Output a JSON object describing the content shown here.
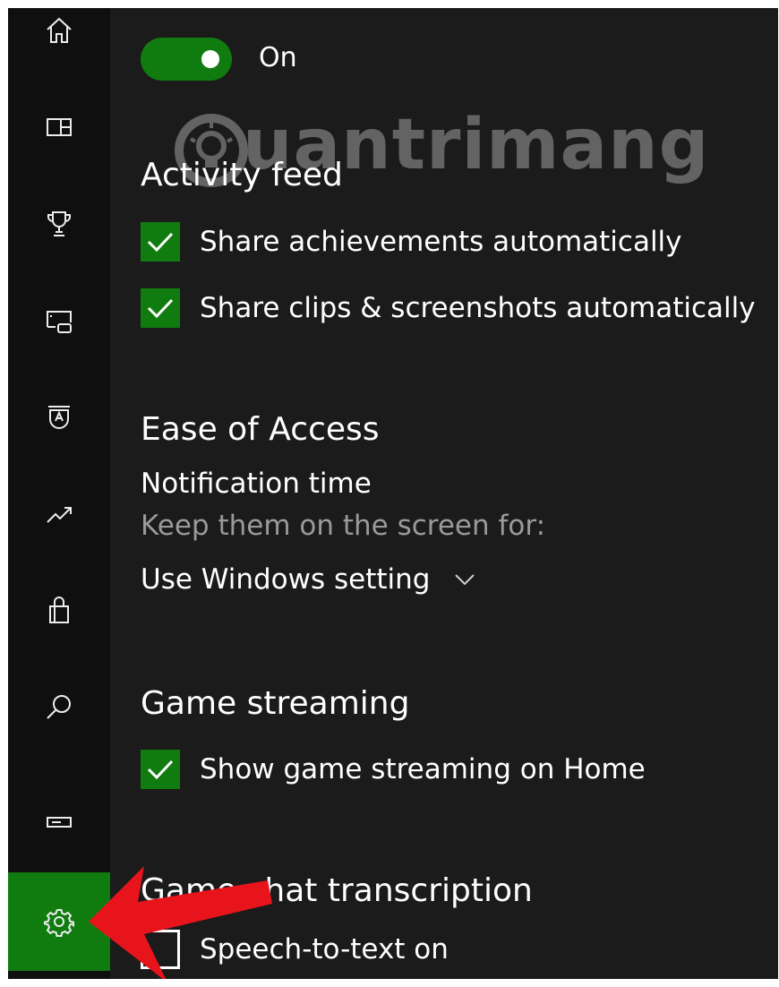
{
  "sidebar": {
    "items": [
      {
        "name": "home-icon"
      },
      {
        "name": "dashboard-icon"
      },
      {
        "name": "trophy-icon"
      },
      {
        "name": "captures-icon"
      },
      {
        "name": "clubs-icon"
      },
      {
        "name": "trending-icon"
      },
      {
        "name": "store-icon"
      },
      {
        "name": "search-icon"
      },
      {
        "name": "connection-icon"
      },
      {
        "name": "gear-icon",
        "active": true
      }
    ]
  },
  "toggle": {
    "label": "On",
    "state": "on"
  },
  "watermark": {
    "text": "uantrimang"
  },
  "activity_feed": {
    "title": "Activity feed",
    "options": [
      {
        "label": "Share achievements automatically",
        "checked": true
      },
      {
        "label": "Share clips & screenshots automatically",
        "checked": true
      }
    ]
  },
  "ease_of_access": {
    "title": "Ease of Access",
    "notification_time": "Notification time",
    "hint": "Keep them on the screen for:",
    "dropdown_value": "Use Windows setting"
  },
  "game_streaming": {
    "title": "Game streaming",
    "options": [
      {
        "label": "Show game streaming on Home",
        "checked": true
      }
    ]
  },
  "game_chat": {
    "title": "Game chat transcription",
    "options": [
      {
        "label": "Speech-to-text on",
        "checked": false
      }
    ]
  },
  "colors": {
    "accent": "#107c10",
    "background": "#1b1b1b",
    "sidebar": "#0f0f0f",
    "arrow": "#e8141c"
  }
}
